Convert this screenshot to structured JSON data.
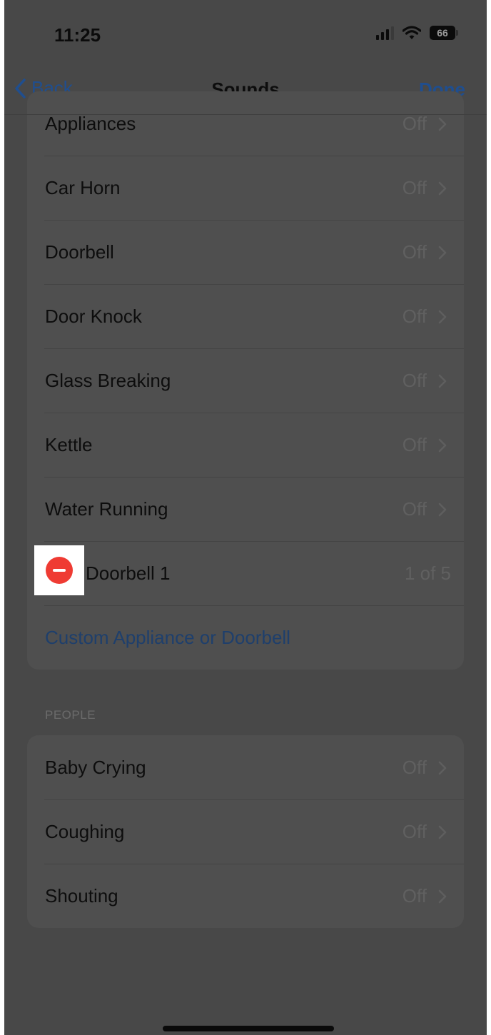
{
  "status_bar": {
    "time": "11:25",
    "battery": "66"
  },
  "nav": {
    "back_label": "Back",
    "title": "Sounds",
    "done_label": "Done"
  },
  "appliances_group": {
    "rows": [
      {
        "label": "Appliances",
        "value": "Off"
      },
      {
        "label": "Car Horn",
        "value": "Off"
      },
      {
        "label": "Doorbell",
        "value": "Off"
      },
      {
        "label": "Door Knock",
        "value": "Off"
      },
      {
        "label": "Glass Breaking",
        "value": "Off"
      },
      {
        "label": "Kettle",
        "value": "Off"
      },
      {
        "label": "Water Running",
        "value": "Off"
      }
    ],
    "custom_row": {
      "label": "Doorbell 1",
      "value": "1 of 5"
    },
    "add_link": "Custom Appliance or Doorbell"
  },
  "people_group": {
    "header": "PEOPLE",
    "rows": [
      {
        "label": "Baby Crying",
        "value": "Off"
      },
      {
        "label": "Coughing",
        "value": "Off"
      },
      {
        "label": "Shouting",
        "value": "Off"
      }
    ]
  },
  "colors": {
    "accent": "#1f4e8f",
    "delete": "#ef3b33"
  },
  "icons": [
    "back-chevron-icon",
    "signal-icon",
    "wifi-icon",
    "battery-icon",
    "chevron-right-icon",
    "delete-minus-icon"
  ]
}
